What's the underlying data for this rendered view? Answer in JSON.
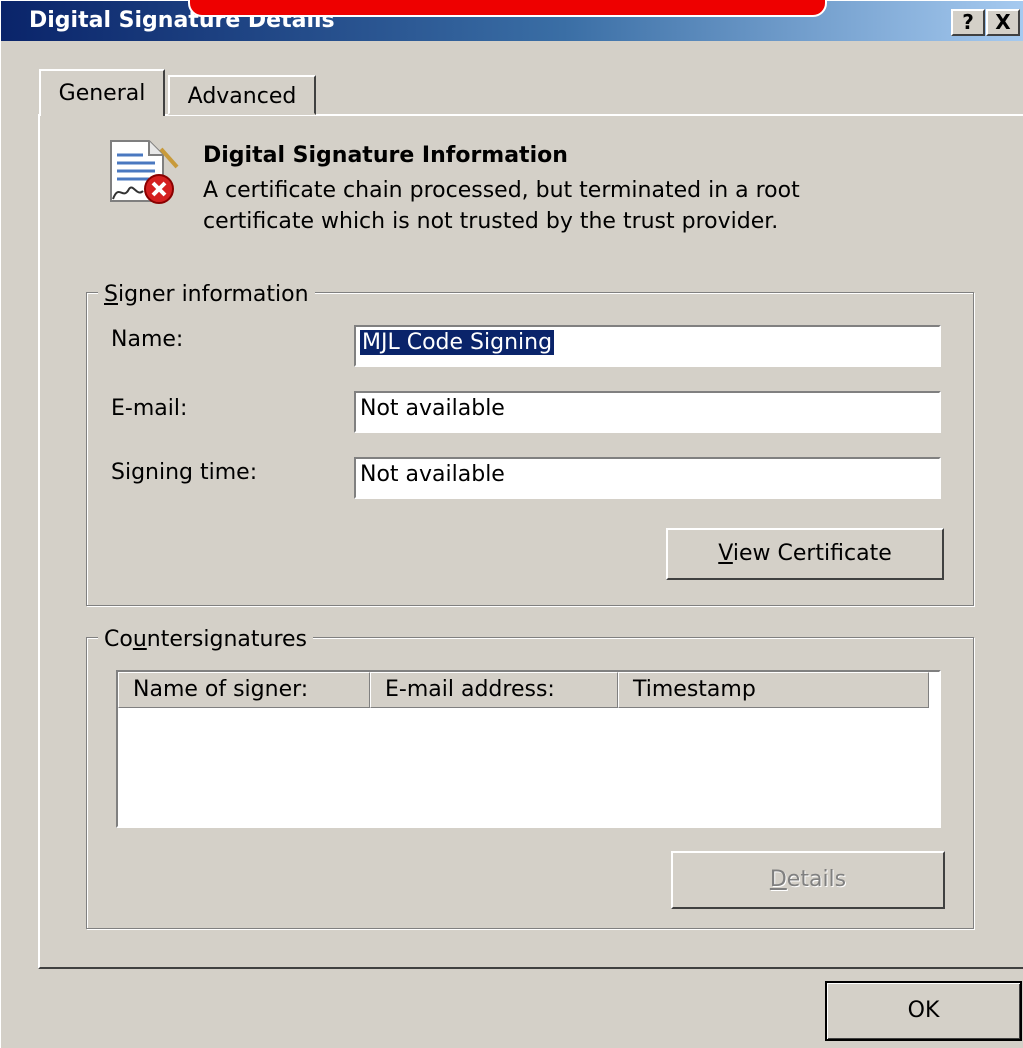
{
  "window": {
    "title": "Digital Signature Details",
    "help_button": "?",
    "close_button": "X"
  },
  "tabs": [
    {
      "label": "General",
      "selected": true
    },
    {
      "label": "Advanced",
      "selected": false
    }
  ],
  "info": {
    "heading": "Digital Signature Information",
    "line1": "A certificate chain processed, but terminated in a root",
    "line2": "certificate which is not trusted by the trust provider.",
    "icon": "certificate-error-icon"
  },
  "signer": {
    "group_label_pre": "",
    "group_label_u": "S",
    "group_label_post": "igner information",
    "name_label": "Name:",
    "name_value": "MJL Code Signing",
    "email_label": "E-mail:",
    "email_value": "Not available",
    "time_label": "Signing time:",
    "time_value": "Not available",
    "view_cert_u": "V",
    "view_cert_rest": "iew Certificate"
  },
  "countersignatures": {
    "group_label_pre": "Co",
    "group_label_u": "u",
    "group_label_post": "ntersignatures",
    "columns": [
      "Name of signer:",
      "E-mail address:",
      "Timestamp"
    ],
    "rows": [],
    "details_u": "D",
    "details_rest": "etails"
  },
  "ok_label": "OK",
  "colors": {
    "title_start": "#0a246a",
    "title_end": "#a6caf0",
    "face": "#d4d0c8",
    "selection": "#0a246a",
    "error_red": "#d42020"
  }
}
